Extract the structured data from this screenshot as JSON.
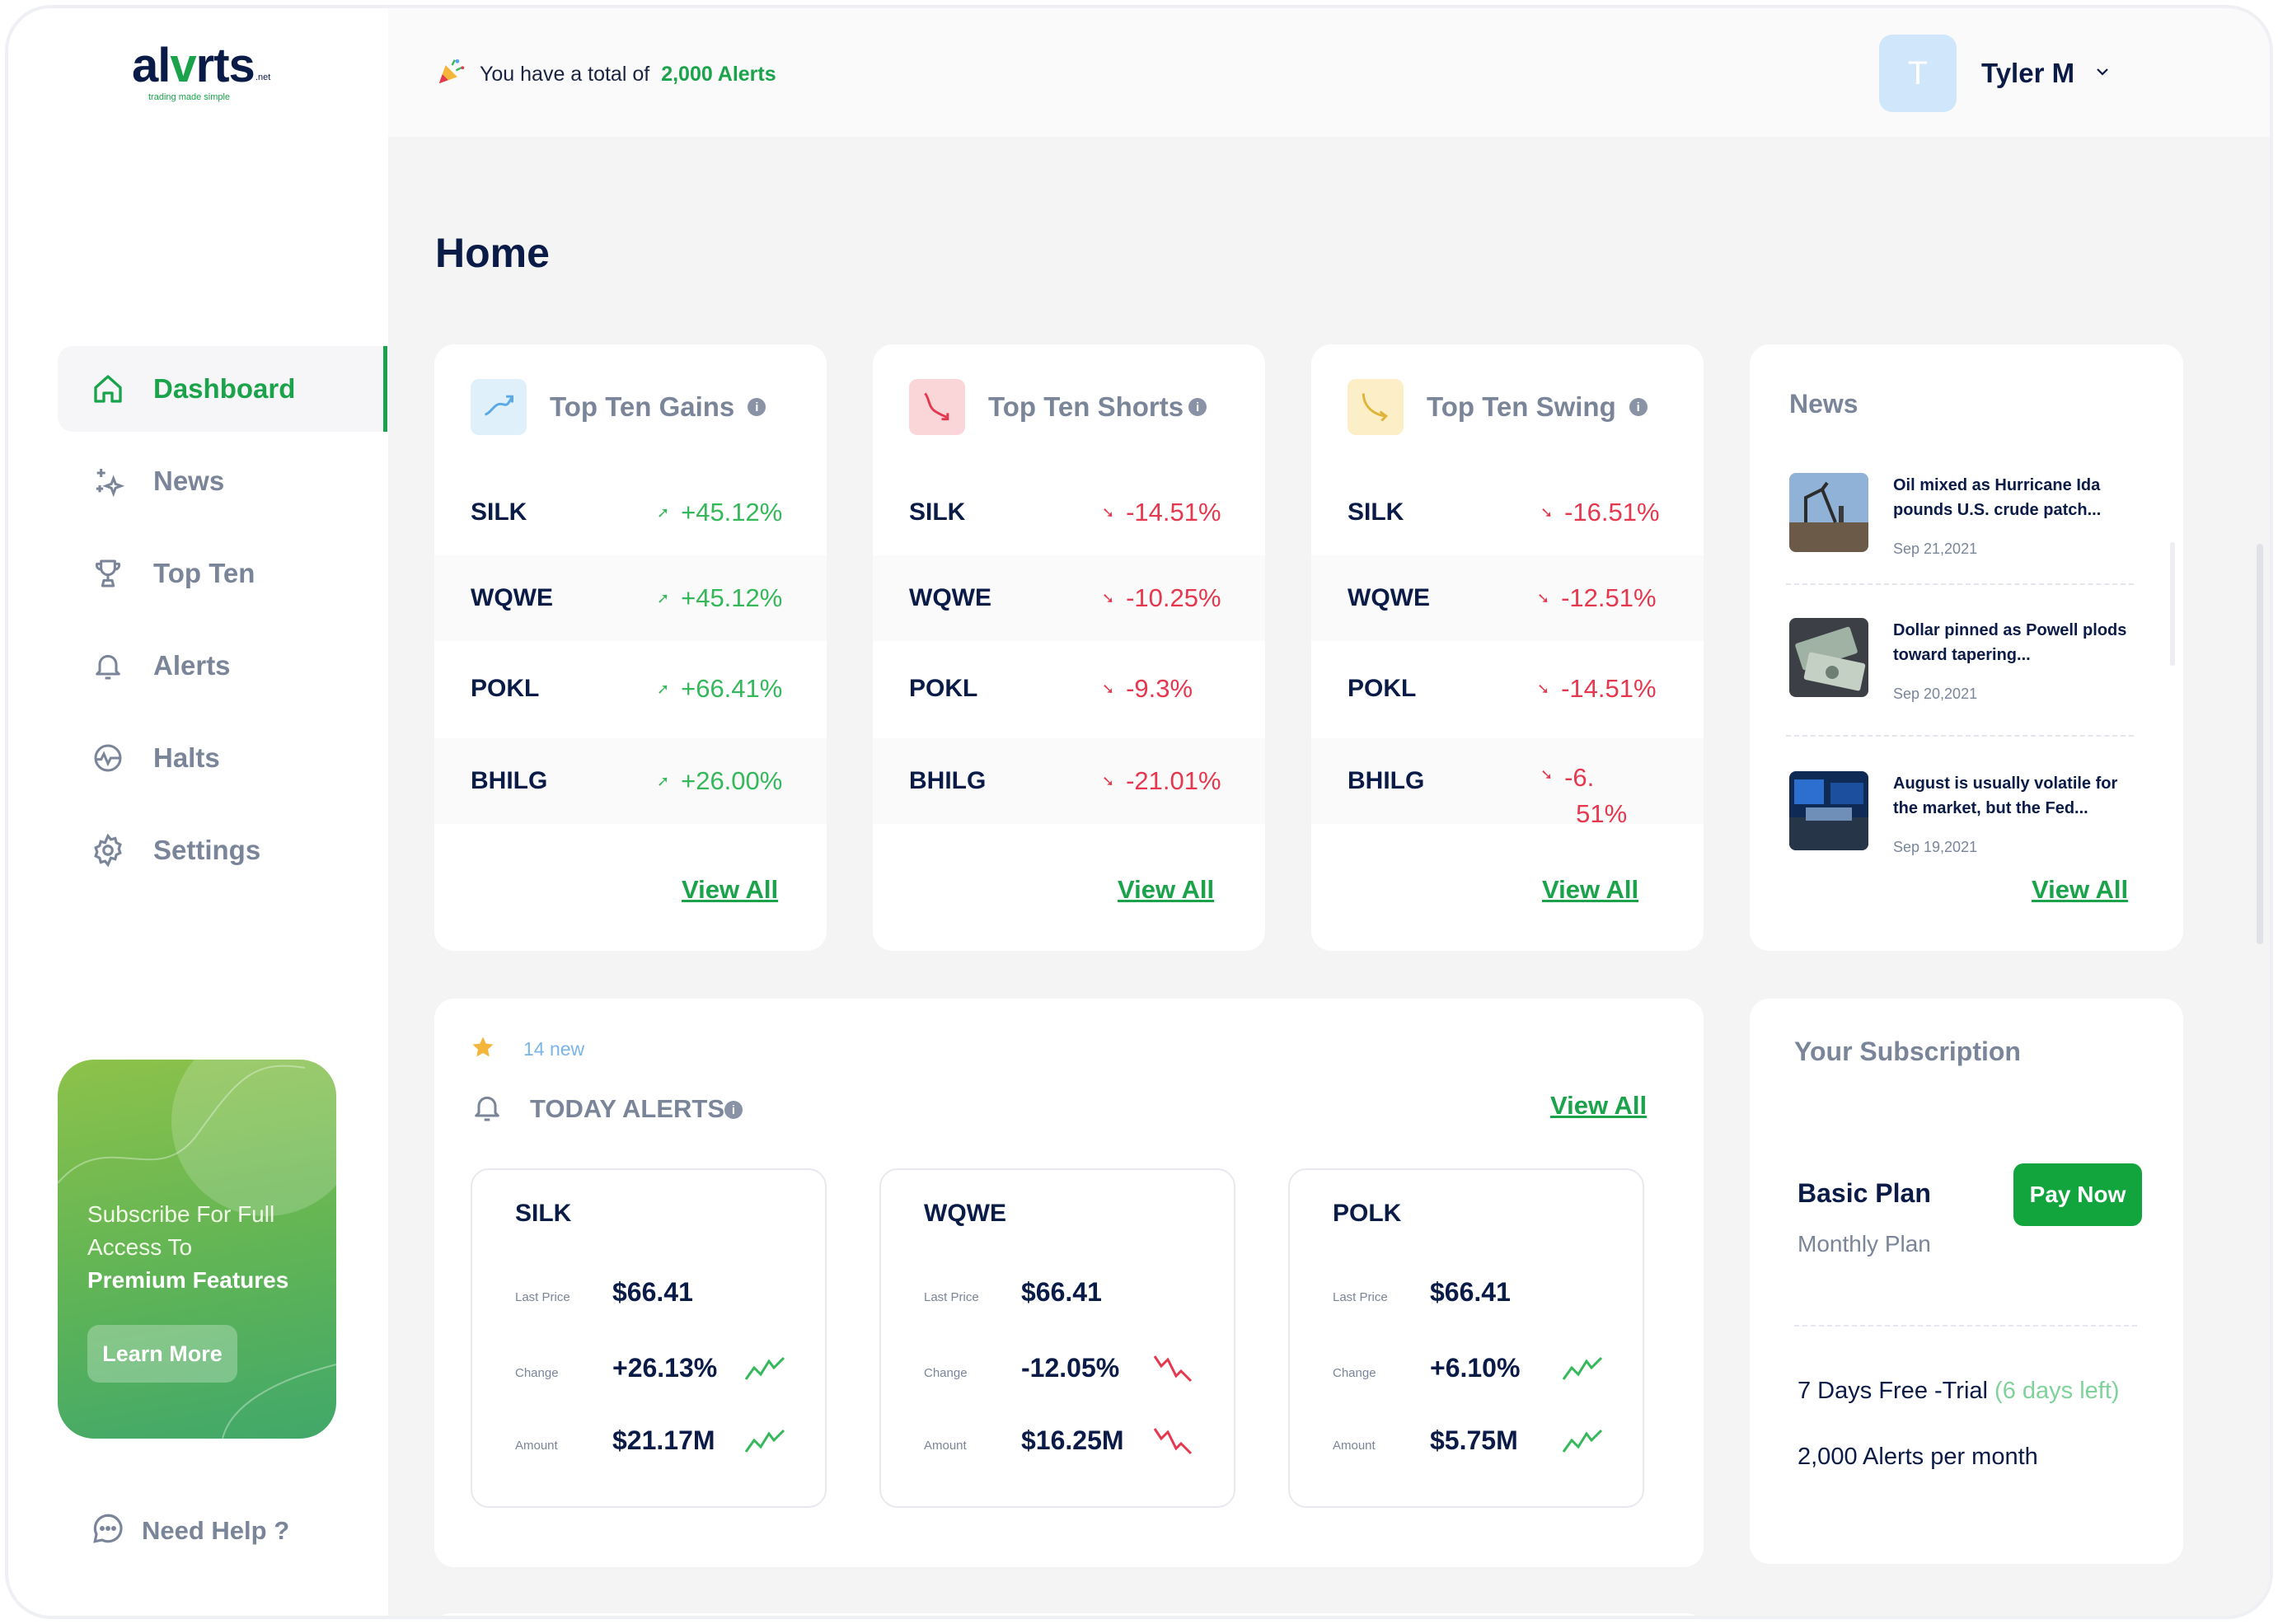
{
  "brand": {
    "logo_left": "al",
    "logo_mark": "v",
    "logo_right": "rts",
    "logo_suffix": ".net",
    "tagline": "trading made simple"
  },
  "sidebar": {
    "items": [
      {
        "label": "Dashboard",
        "icon": "home-icon"
      },
      {
        "label": "News",
        "icon": "sparkles-icon"
      },
      {
        "label": "Top Ten",
        "icon": "trophy-icon"
      },
      {
        "label": "Alerts",
        "icon": "bell-icon"
      },
      {
        "label": "Halts",
        "icon": "pulse-icon"
      },
      {
        "label": "Settings",
        "icon": "gear-icon"
      }
    ],
    "promo": {
      "line1": "Subscribe For Full Access To",
      "line2": "Premium Features",
      "button": "Learn More"
    },
    "help": "Need Help ?"
  },
  "header": {
    "notice_prefix": "You have a total of",
    "notice_count": "2,000 Alerts",
    "user_initial": "T",
    "user_name": "Tyler M"
  },
  "page_title": "Home",
  "gains": {
    "title": "Top Ten Gains",
    "rows": [
      {
        "symbol": "SILK",
        "value": "+45.12%"
      },
      {
        "symbol": "WQWE",
        "value": "+45.12%"
      },
      {
        "symbol": "POKL",
        "value": "+66.41%"
      },
      {
        "symbol": "BHILG",
        "value": "+26.00%"
      }
    ],
    "view_all": "View All"
  },
  "shorts": {
    "title": "Top Ten Shorts",
    "rows": [
      {
        "symbol": "SILK",
        "value": "-14.51%"
      },
      {
        "symbol": "WQWE",
        "value": "-10.25%"
      },
      {
        "symbol": "POKL",
        "value": "-9.3%"
      },
      {
        "symbol": "BHILG",
        "value": "-21.01%"
      }
    ],
    "view_all": "View All"
  },
  "swing": {
    "title": "Top Ten Swing",
    "rows": [
      {
        "symbol": "SILK",
        "value": "-16.51%"
      },
      {
        "symbol": "WQWE",
        "value": "-12.51%"
      },
      {
        "symbol": "POKL",
        "value": "-14.51%"
      },
      {
        "symbol": "BHILG",
        "value": "-6.",
        "value2": "51%"
      }
    ],
    "view_all": "View All"
  },
  "news": {
    "title": "News",
    "items": [
      {
        "headline": "Oil mixed as Hurricane Ida pounds U.S. crude patch...",
        "date": "Sep 21,2021"
      },
      {
        "headline": "Dollar pinned as Powell plods toward tapering...",
        "date": "Sep 20,2021"
      },
      {
        "headline": "August is usually volatile for the market, but the Fed...",
        "date": "Sep 19,2021"
      }
    ],
    "view_all": "View All"
  },
  "alerts": {
    "new_count": "14 new",
    "title": "TODAY ALERTS",
    "view_all": "View All",
    "labels": {
      "last_price": "Last Price",
      "change": "Change",
      "amount": "Amount"
    },
    "cards": [
      {
        "symbol": "SILK",
        "last_price": "$66.41",
        "change": "+26.13%",
        "amount": "$21.17M",
        "trend": "up"
      },
      {
        "symbol": "WQWE",
        "last_price": "$66.41",
        "change": "-12.05%",
        "amount": "$16.25M",
        "trend": "down"
      },
      {
        "symbol": "POLK",
        "last_price": "$66.41",
        "change": "+6.10%",
        "amount": "$5.75M",
        "trend": "up"
      }
    ]
  },
  "subscription": {
    "title": "Your Subscription",
    "plan": "Basic Plan",
    "pay_button": "Pay Now",
    "period": "Monthly Plan",
    "trial": "7 Days Free -Trial",
    "trial_left": "(6 days left)",
    "quota": "2,000 Alerts per month"
  },
  "colors": {
    "accent": "#1aa34a",
    "gain": "#34b85a",
    "loss": "#e5384e",
    "navy": "#0b1b47",
    "muted": "#7a8599"
  }
}
